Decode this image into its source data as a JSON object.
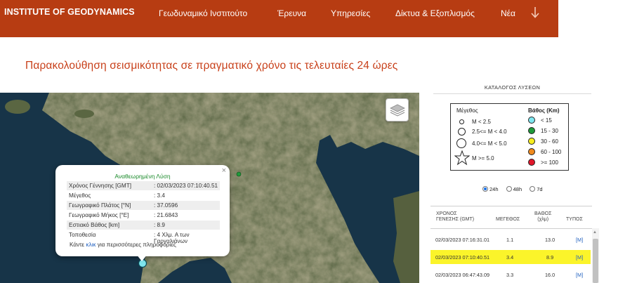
{
  "header": {
    "brand": "INSTITUTE OF GEODYNAMICS",
    "nav": [
      "Γεωδυναμικό Ινστιτούτο",
      "Έρευνα",
      "Υπηρεσίες",
      "Δίκτυα & Εξοπλισμός",
      "Νέα"
    ],
    "nav_more_icon": "arrow-down-icon",
    "bg_color": "#b73c12"
  },
  "page_title": "Παρακολούθηση σεισμικότητας σε πραγματικό χρόνο τις τελευταίες 24 ώρες",
  "map": {
    "layers_icon": "layers-icon",
    "popup": {
      "title": "Αναθεωρημένη Λύση",
      "close": "×",
      "rows": [
        {
          "label": "Χρόνος Γέννησης [GMT]",
          "value": ": 02/03/2023 07:10:40.51"
        },
        {
          "label": "Μέγεθος",
          "value": ": 3.4"
        },
        {
          "label": "Γεωγραφικό Πλάτος [°N]",
          "value": ": 37.0596"
        },
        {
          "label": "Γεωγραφικό Μήκος [°E]",
          "value": ": 21.6843"
        },
        {
          "label": "Εστιακό Βάθος [km]",
          "value": ": 8.9"
        },
        {
          "label": "Τοποθεσία",
          "value": ": 4 Χλμ. Α των Γαργαλιάνων"
        }
      ],
      "footer_pre": "Κάντε ",
      "footer_link": "κλικ",
      "footer_post": " για περισσότερες πληροφορίες"
    }
  },
  "catalog": {
    "title": "ΚΑΤΑΛΟΓΟΣ ΛΥΣΕΩΝ",
    "legend": {
      "magnitude_header": "Μέγεθος",
      "depth_header": "Βάθος (Km)",
      "magnitudes": [
        "M  < 2.5",
        "2.5<= M < 4.0",
        "4.0<= M < 5.0",
        "M >= 5.0"
      ],
      "depths": [
        {
          "label": "< 15",
          "color": "#7fe6ef"
        },
        {
          "label": "15 - 30",
          "color": "#1f9a3a"
        },
        {
          "label": "30 - 60",
          "color": "#f7ee1f"
        },
        {
          "label": "60 - 100",
          "color": "#f08a1e"
        },
        {
          "label": ">= 100",
          "color": "#e0162a"
        }
      ]
    },
    "ranges": [
      {
        "label": "24h",
        "selected": true
      },
      {
        "label": "48h",
        "selected": false
      },
      {
        "label": "7d",
        "selected": false
      }
    ],
    "table": {
      "headers": [
        "ΧΡΟΝΟΣ ΓΕΝΕΣΗΣ (GMT)",
        "ΜΕΓΕΘΟΣ",
        "ΒΑΘΟΣ (χλμ)",
        "ΤΥΠΟΣ"
      ],
      "header_time_l1": "ΧΡΟΝΟΣ",
      "header_time_l2": "ΓΕΝΕΣΗΣ (GMT)",
      "header_depth_l1": "ΒΑΘΟΣ",
      "header_depth_l2": "(χλμ)",
      "rows": [
        {
          "time": "02/03/2023 07:16:31.01",
          "mag": "1.1",
          "depth": "13.0",
          "type": "[M]",
          "highlight": false
        },
        {
          "time": "02/03/2023 07:10:40.51",
          "mag": "3.4",
          "depth": "8.9",
          "type": "[M]",
          "highlight": true
        },
        {
          "time": "02/03/2023 06:47:43.09",
          "mag": "3.3",
          "depth": "16.0",
          "type": "[M]",
          "highlight": false
        }
      ]
    }
  }
}
